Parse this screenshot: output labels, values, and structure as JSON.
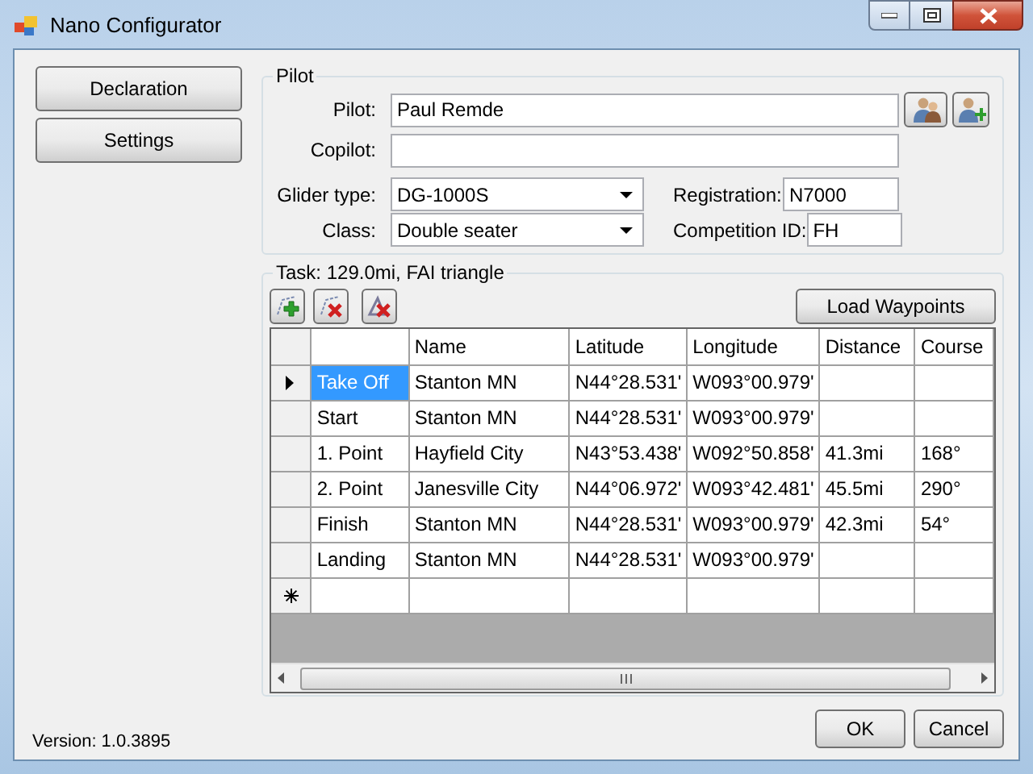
{
  "window": {
    "title": "Nano Configurator"
  },
  "sidebar": {
    "buttons": [
      "Declaration",
      "Settings"
    ]
  },
  "pilot_group": {
    "title": "Pilot",
    "pilot": {
      "label": "Pilot:",
      "value": "Paul Remde"
    },
    "copilot": {
      "label": "Copilot:"
    },
    "glider_type": {
      "label": "Glider type:",
      "value": "DG-1000S"
    },
    "registration": {
      "label": "Registration:",
      "value": "N7000"
    },
    "class": {
      "label": "Class:",
      "value": "Double seater"
    },
    "competition_id": {
      "label": "Competition ID:",
      "value": "FH"
    }
  },
  "task_group": {
    "title": "Task: 129.0mi, FAI triangle",
    "load_button": "Load Waypoints",
    "table": {
      "columns": [
        "Name",
        "Latitude",
        "Longitude",
        "Distance",
        "Course"
      ],
      "rows": [
        {
          "point": "Take Off",
          "name": "Stanton MN",
          "latitude": "N44°28.531'",
          "longitude": "W093°00.979'",
          "selected": true
        },
        {
          "point": "Start",
          "name": "Stanton MN",
          "latitude": "N44°28.531'",
          "longitude": "W093°00.979'",
          "selected": false
        },
        {
          "point": "1. Point",
          "name": "Hayfield City",
          "latitude": "N43°53.438'",
          "longitude": "W092°50.858'",
          "distance": "41.3mi",
          "course": "168°",
          "selected": false
        },
        {
          "point": "2. Point",
          "name": "Janesville City",
          "latitude": "N44°06.972'",
          "longitude": "W093°42.481'",
          "distance": "45.5mi",
          "course": "290°",
          "selected": false
        },
        {
          "point": "Finish",
          "name": "Stanton MN",
          "latitude": "N44°28.531'",
          "longitude": "W093°00.979'",
          "distance": "42.3mi",
          "course": "54°",
          "selected": false
        },
        {
          "point": "Landing",
          "name": "Stanton MN",
          "latitude": "N44°28.531'",
          "longitude": "W093°00.979'",
          "selected": false
        }
      ]
    }
  },
  "footer": {
    "version": "Version: 1.0.3895",
    "buttons": [
      "OK",
      "Cancel"
    ]
  }
}
